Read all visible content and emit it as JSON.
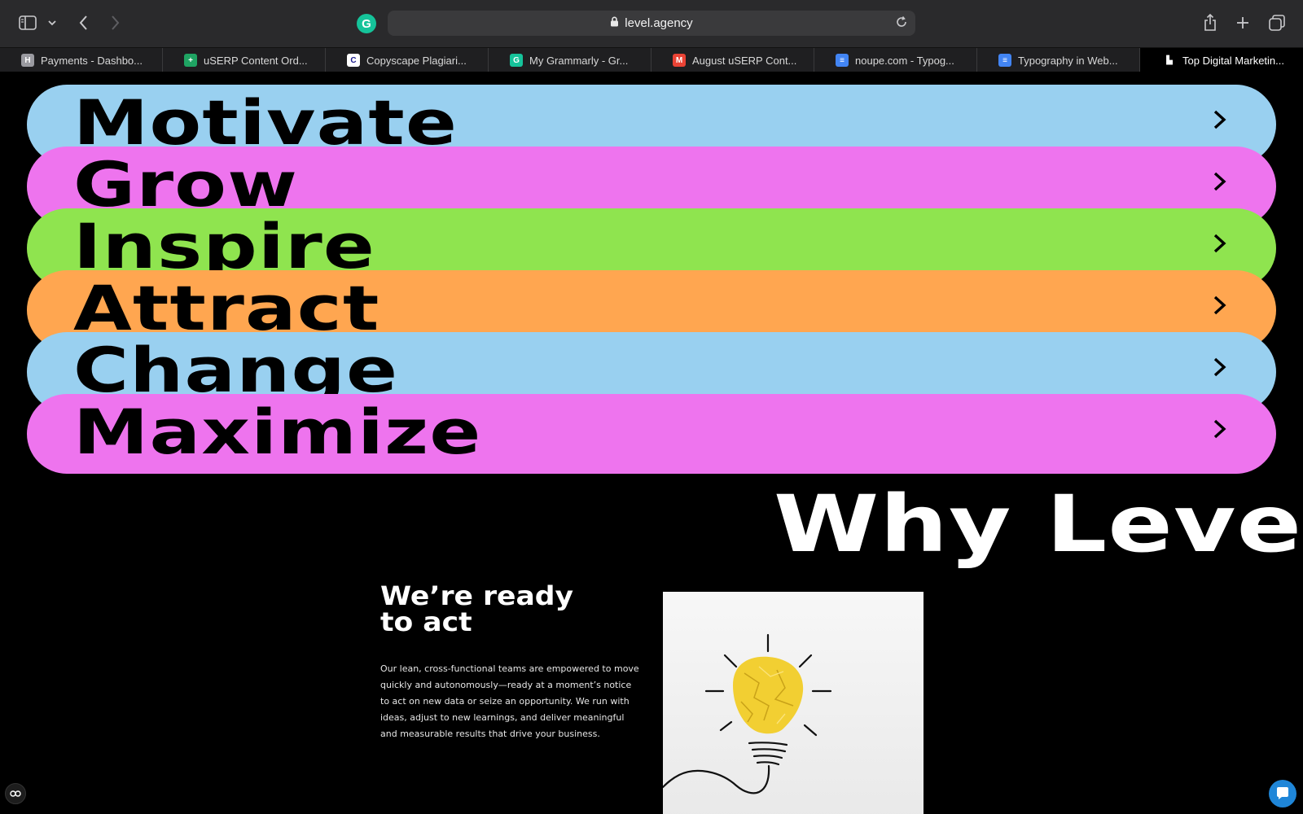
{
  "browser": {
    "url": "level.agency",
    "tabs": [
      {
        "label": "Payments - Dashbo...",
        "favicon": "H",
        "favicon_color": "#9a9aa0",
        "active": false
      },
      {
        "label": "uSERP Content Ord...",
        "favicon": "+",
        "favicon_color": "#1fa463",
        "active": false
      },
      {
        "label": "Copyscape Plagiari...",
        "favicon": "C",
        "favicon_color": "#ffffff",
        "active": false
      },
      {
        "label": "My Grammarly - Gr...",
        "favicon": "G",
        "favicon_color": "#15c39a",
        "active": false
      },
      {
        "label": "August uSERP Cont...",
        "favicon": "M",
        "favicon_color": "#ea4335",
        "active": false
      },
      {
        "label": "noupe.com - Typog...",
        "favicon": "≡",
        "favicon_color": "#4285f4",
        "active": false
      },
      {
        "label": "Typography in Web...",
        "favicon": "≡",
        "favicon_color": "#4285f4",
        "active": false
      },
      {
        "label": "Top Digital Marketin...",
        "favicon": "▙",
        "favicon_color": "#000000",
        "active": true
      }
    ]
  },
  "menu": [
    {
      "word": "Motivate",
      "color": "#99d0f0"
    },
    {
      "word": "Grow",
      "color": "#ee74ee"
    },
    {
      "word": "Inspire",
      "color": "#8fe44f"
    },
    {
      "word": "Attract",
      "color": "#ffa650"
    },
    {
      "word": "Change",
      "color": "#99d0f0"
    },
    {
      "word": "Maximize",
      "color": "#ee74ee"
    }
  ],
  "section": {
    "heading": "Why Level",
    "subheading_line1": "We’re ready",
    "subheading_line2": "to act",
    "body": "Our lean, cross-functional teams are empowered to move quickly and autonomously—ready at a moment’s notice to act on new data or seize an opportunity. We run with ideas, adjust to new learnings, and deliver meaningful and measurable results that drive your business.",
    "image": "crumpled-paper-lightbulb"
  }
}
